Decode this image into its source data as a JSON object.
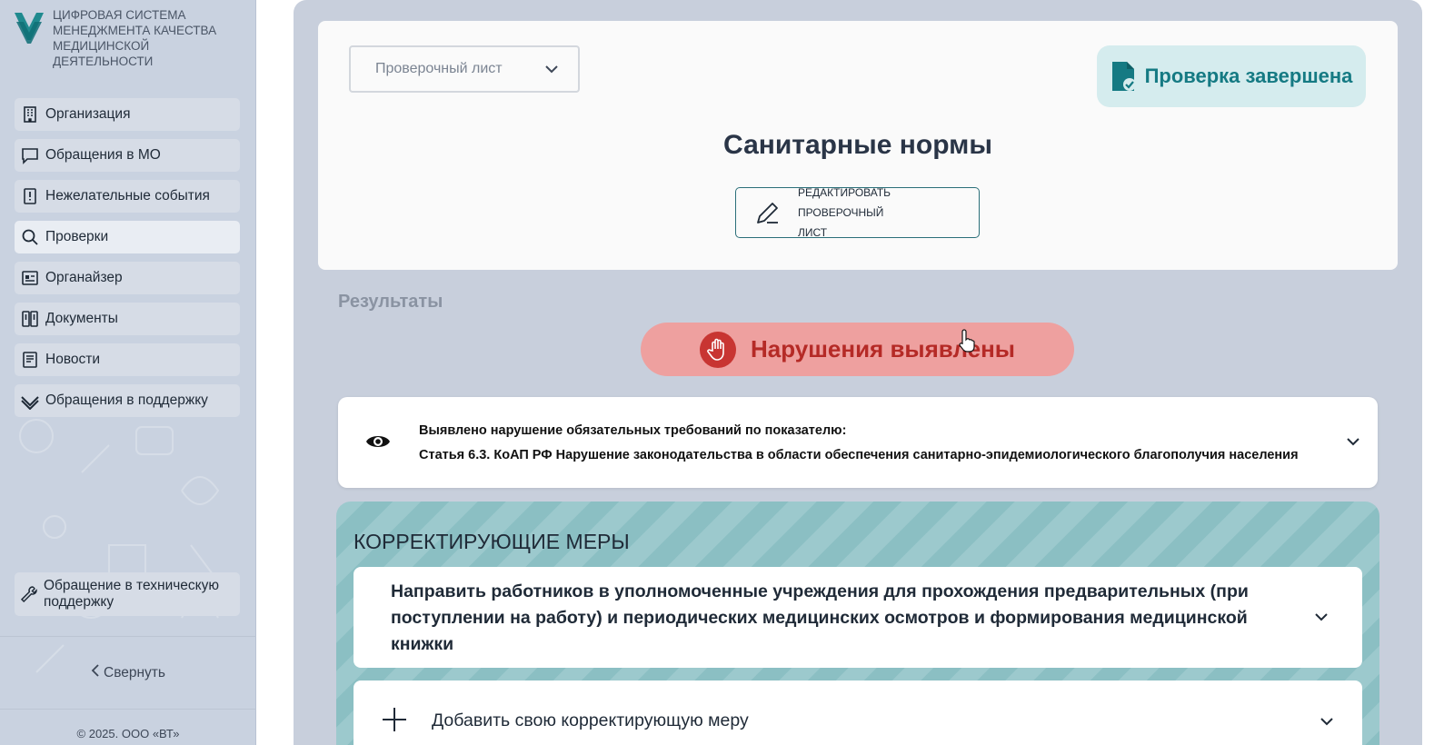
{
  "sidebar": {
    "logo_text": "ЦИФРОВАЯ СИСТЕМА МЕНЕДЖМЕНТА КАЧЕСТВА МЕДИЦИНСКОЙ ДЕЯТЕЛЬНОСТИ",
    "items": [
      {
        "label": "Организация",
        "icon": "building-icon"
      },
      {
        "label": "Обращения в МО",
        "icon": "chat-icon"
      },
      {
        "label": "Нежелательные события",
        "icon": "book-alert-icon"
      },
      {
        "label": "Проверки",
        "icon": "search-icon",
        "active": true
      },
      {
        "label": "Органайзер",
        "icon": "organizer-icon"
      },
      {
        "label": "Документы",
        "icon": "documents-icon"
      },
      {
        "label": "Новости",
        "icon": "news-icon"
      },
      {
        "label": "Обращения в поддержку",
        "icon": "support-check-icon"
      }
    ],
    "tech_support_label": "Обращение в техническую поддержку",
    "collapse_label": "Свернуть",
    "copyright": "© 2025. ООО «ВТ»"
  },
  "header": {
    "select_value": "Проверочный лист",
    "status_badge": "Проверка завершена",
    "title": "Санитарные нормы",
    "edit_button": "РЕДАКТИРОВАТЬ ПРОВЕРОЧНЫЙ ЛИСТ"
  },
  "results": {
    "label": "Результаты",
    "violation_status": "Нарушения выявлены",
    "finding_line1": "Выявлено нарушение обязательных требований по показателю:",
    "finding_line2": "Статья 6.3. КоАП РФ Нарушение законодательства в области обеспечения санитарно-эпидемиологического благополучия населения"
  },
  "measures": {
    "title": "КОРРЕКТИРУЮЩИЕ МЕРЫ",
    "items": [
      {
        "text": "Направить работников в уполномоченные учреждения для прохождения предварительных (при поступлении на работу) и периодических медицинских осмотров и формирования медицинской книжки"
      }
    ],
    "add_label": "Добавить свою корректирующую меру"
  },
  "colors": {
    "accent": "#157a83",
    "violation": "#b52a26",
    "sidebar_bg": "#c9d2e0"
  }
}
